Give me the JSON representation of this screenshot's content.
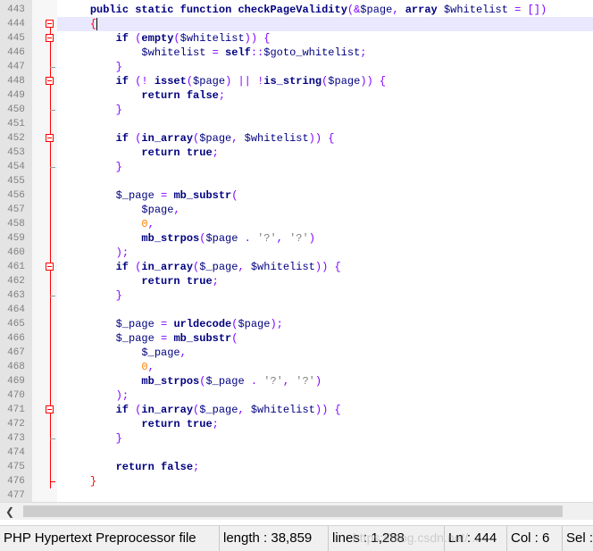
{
  "editor": {
    "current_line": "444",
    "lines": [
      {
        "n": "443",
        "text": "    public static function checkPageValidity(&$page, array $whitelist = [])"
      },
      {
        "n": "444",
        "text": "    {"
      },
      {
        "n": "445",
        "text": "        if (empty($whitelist)) {"
      },
      {
        "n": "446",
        "text": "            $whitelist = self::$goto_whitelist;"
      },
      {
        "n": "447",
        "text": "        }"
      },
      {
        "n": "448",
        "text": "        if (! isset($page) || !is_string($page)) {"
      },
      {
        "n": "449",
        "text": "            return false;"
      },
      {
        "n": "450",
        "text": "        }"
      },
      {
        "n": "451",
        "text": ""
      },
      {
        "n": "452",
        "text": "        if (in_array($page, $whitelist)) {"
      },
      {
        "n": "453",
        "text": "            return true;"
      },
      {
        "n": "454",
        "text": "        }"
      },
      {
        "n": "455",
        "text": ""
      },
      {
        "n": "456",
        "text": "        $_page = mb_substr("
      },
      {
        "n": "457",
        "text": "            $page,"
      },
      {
        "n": "458",
        "text": "            0,"
      },
      {
        "n": "459",
        "text": "            mb_strpos($page . '?', '?')"
      },
      {
        "n": "460",
        "text": "        );"
      },
      {
        "n": "461",
        "text": "        if (in_array($_page, $whitelist)) {"
      },
      {
        "n": "462",
        "text": "            return true;"
      },
      {
        "n": "463",
        "text": "        }"
      },
      {
        "n": "464",
        "text": ""
      },
      {
        "n": "465",
        "text": "        $_page = urldecode($page);"
      },
      {
        "n": "466",
        "text": "        $_page = mb_substr("
      },
      {
        "n": "467",
        "text": "            $_page,"
      },
      {
        "n": "468",
        "text": "            0,"
      },
      {
        "n": "469",
        "text": "            mb_strpos($_page . '?', '?')"
      },
      {
        "n": "470",
        "text": "        );"
      },
      {
        "n": "471",
        "text": "        if (in_array($_page, $whitelist)) {"
      },
      {
        "n": "472",
        "text": "            return true;"
      },
      {
        "n": "473",
        "text": "        }"
      },
      {
        "n": "474",
        "text": ""
      },
      {
        "n": "475",
        "text": "        return false;"
      },
      {
        "n": "476",
        "text": "    }"
      },
      {
        "n": "477",
        "text": ""
      }
    ]
  },
  "fold_markers": {
    "444": "box-down",
    "445": "box",
    "446": "line",
    "447": "end",
    "448": "box",
    "449": "line",
    "450": "end",
    "451": "line",
    "452": "box",
    "453": "line",
    "454": "end",
    "455": "line",
    "456": "line",
    "457": "line",
    "458": "line",
    "459": "line",
    "460": "line",
    "461": "box",
    "462": "line",
    "463": "end",
    "464": "line",
    "465": "line",
    "466": "line",
    "467": "line",
    "468": "line",
    "469": "line",
    "470": "line",
    "471": "box",
    "472": "line",
    "473": "end",
    "474": "line",
    "475": "line",
    "476": "end-red"
  },
  "colors": {
    "keyword": "#000080",
    "function": "#000080",
    "variable": "#000080",
    "number": "#ff8000",
    "string": "#808080",
    "operator": "#8000ff",
    "brace": "#8000ff",
    "red_brace": "#ff0000",
    "fold_marker": "#ff0000",
    "gutter_bg": "#e4e4e4",
    "current_line_bg": "#e8e8ff"
  },
  "status": {
    "file_type": "PHP Hypertext Preprocessor file",
    "length": "length : 38,859",
    "lines": "lines : 1,288",
    "ln": "Ln : 444",
    "col": "Col : 6",
    "sel": "Sel :"
  },
  "scrollbar": {
    "left_icon": "chevron-left-icon"
  },
  "watermark": "https://blog.csdn.net/..."
}
